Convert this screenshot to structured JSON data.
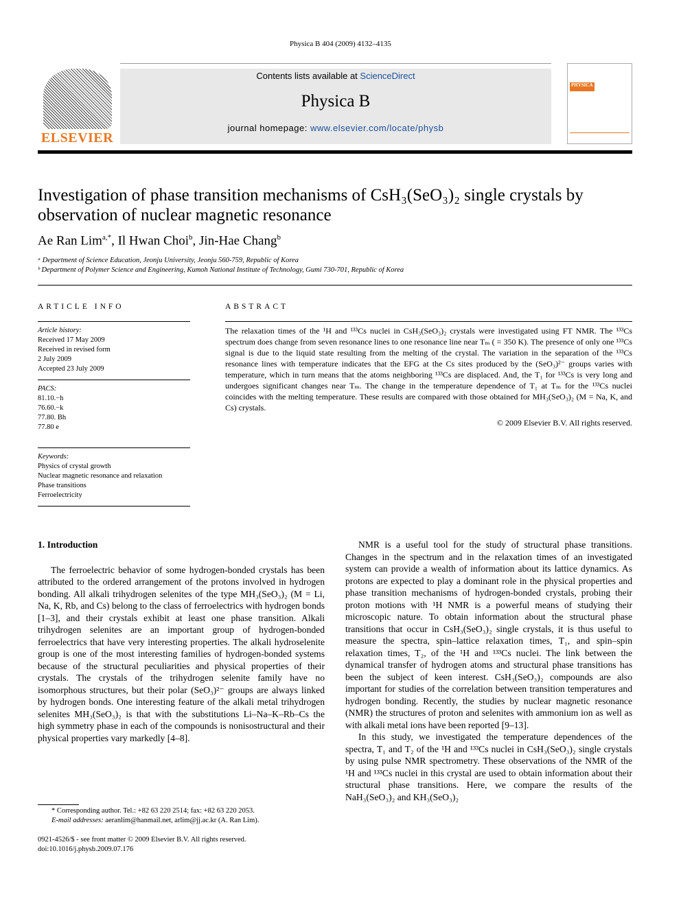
{
  "header": {
    "journal_ref": "Physica B 404 (2009) 4132–4135",
    "contents_prefix": "Contents lists available at ",
    "sciencedirect": "ScienceDirect",
    "journal_title": "Physica B",
    "homepage_prefix": "journal homepage: ",
    "homepage_url": "www.elsevier.com/locate/physb",
    "publisher": "ELSEVIER",
    "cover_label": "PHYSICA"
  },
  "article": {
    "title": "Investigation of phase transition mechanisms of CsH₃(SeO₃)₂ single crystals by observation of nuclear magnetic resonance",
    "authors": [
      {
        "name": "Ae Ran Lim",
        "sup": "a,*"
      },
      {
        "name": "Il Hwan Choi",
        "sup": "b"
      },
      {
        "name": "Jin-Hae Chang",
        "sup": "b"
      }
    ],
    "affiliations": [
      "ᵃ Department of Science Education, Jeonju University, Jeonju 560-759, Republic of Korea",
      "ᵇ Department of Polymer Science and Engineering, Kumoh National Institute of Technology, Gumi 730-701, Republic of Korea"
    ]
  },
  "info": {
    "heading": "ARTICLE INFO",
    "history_label": "Article history:",
    "history": [
      "Received 17 May 2009",
      "Received in revised form",
      "2 July 2009",
      "Accepted 23 July 2009"
    ],
    "pacs_label": "PACS:",
    "pacs": [
      "81.10.−h",
      "76.60.−k",
      "77.80. Bh",
      "77.80 e"
    ],
    "keywords_label": "Keywords:",
    "keywords": [
      "Physics of crystal growth",
      "Nuclear magnetic resonance and relaxation",
      "Phase transitions",
      "Ferroelectricity"
    ]
  },
  "abstract": {
    "heading": "ABSTRACT",
    "text": "The relaxation times of the ¹H and ¹³³Cs nuclei in CsH₃(SeO₃)₂ crystals were investigated using FT NMR. The ¹³³Cs spectrum does change from seven resonance lines to one resonance line near Tₘ ( = 350 K). The presence of only one ¹³³Cs signal is due to the liquid state resulting from the melting of the crystal. The variation in the separation of the ¹³³Cs resonance lines with temperature indicates that the EFG at the Cs sites produced by the (SeO₃)²⁻ groups varies with temperature, which in turn means that the atoms neighboring ¹³³Cs are displaced. And, the T₁ for ¹³³Cs is very long and undergoes significant changes near Tₘ. The change in the temperature dependence of T₁ at Tₘ for the ¹³³Cs nuclei coincides with the melting temperature. These results are compared with those obtained for MH₃(SeO₃)₂ (M = Na, K, and Cs) crystals.",
    "copyright": "© 2009 Elsevier B.V. All rights reserved."
  },
  "body": {
    "section_heading": "1.  Introduction",
    "p1": "The ferroelectric behavior of some hydrogen-bonded crystals has been attributed to the ordered arrangement of the protons involved in hydrogen bonding. All alkali trihydrogen selenites of the type MH₃(SeO₃)₂ (M = Li, Na, K, Rb, and Cs) belong to the class of ferroelectrics with hydrogen bonds [1–3], and their crystals exhibit at least one phase transition. Alkali trihydrogen selenites are an important group of hydrogen-bonded ferroelectrics that have very interesting properties. The alkali hydroselenite group is one of the most interesting families of hydrogen-bonded systems because of the structural peculiarities and physical properties of their crystals. The crystals of the trihydrogen selenite family have no isomorphous structures, but their polar (SeO₃)²⁻ groups are always linked by hydrogen bonds. One interesting feature of the alkali metal trihydrogen selenites MH₃(SeO₃)₂ is that with the substitutions Li–Na–K–Rb–Cs the high symmetry phase in each of the compounds is nonisostructural and their physical properties vary markedly [4–8].",
    "p2": "NMR is a useful tool for the study of structural phase transitions. Changes in the spectrum and in the relaxation times of an investigated system can provide a wealth of information about its lattice dynamics. As protons are expected to play a dominant role in the physical properties and phase transition mechanisms of hydrogen-bonded crystals, probing their proton motions with ¹H NMR is a powerful means of studying their microscopic nature. To obtain information about the structural phase transitions that occur in CsH₃(SeO₃)₂ single crystals, it is thus useful to measure the spectra, spin–lattice relaxation times, T₁, and spin–spin relaxation times, T₂, of the ¹H and ¹³³Cs nuclei. The link between the dynamical transfer of hydrogen atoms and structural phase transitions has been the subject of keen interest. CsH₃(SeO₃)₂ compounds are also important for studies of the correlation between transition temperatures and hydrogen bonding. Recently, the studies by nuclear magnetic resonance (NMR) the structures of proton and selenites with ammonium ion as well as with alkali metal ions have been reported [9–13].",
    "p3": "In this study, we investigated the temperature dependences of the spectra, T₁ and T₂ of the ¹H and ¹³³Cs nuclei in CsH₃(SeO₃)₂ single crystals by using pulse NMR spectrometry. These observations of the NMR of the ¹H and ¹³³Cs nuclei in this crystal are used to obtain information about their structural phase transitions. Here, we compare the results of the NaH₃(SeO₃)₂ and KH₃(SeO₃)₂"
  },
  "footer": {
    "corresponding": "* Corresponding author. Tel.: +82 63 220 2514; fax: +82 63 220 2053.",
    "email_label": "E-mail addresses: ",
    "emails": "aeranlim@hanmail.net, arlim@jj.ac.kr (A. Ran Lim).",
    "front_matter": "0921-4526/$ - see front matter © 2009 Elsevier B.V. All rights reserved.",
    "doi": "doi:10.1016/j.physb.2009.07.176"
  }
}
